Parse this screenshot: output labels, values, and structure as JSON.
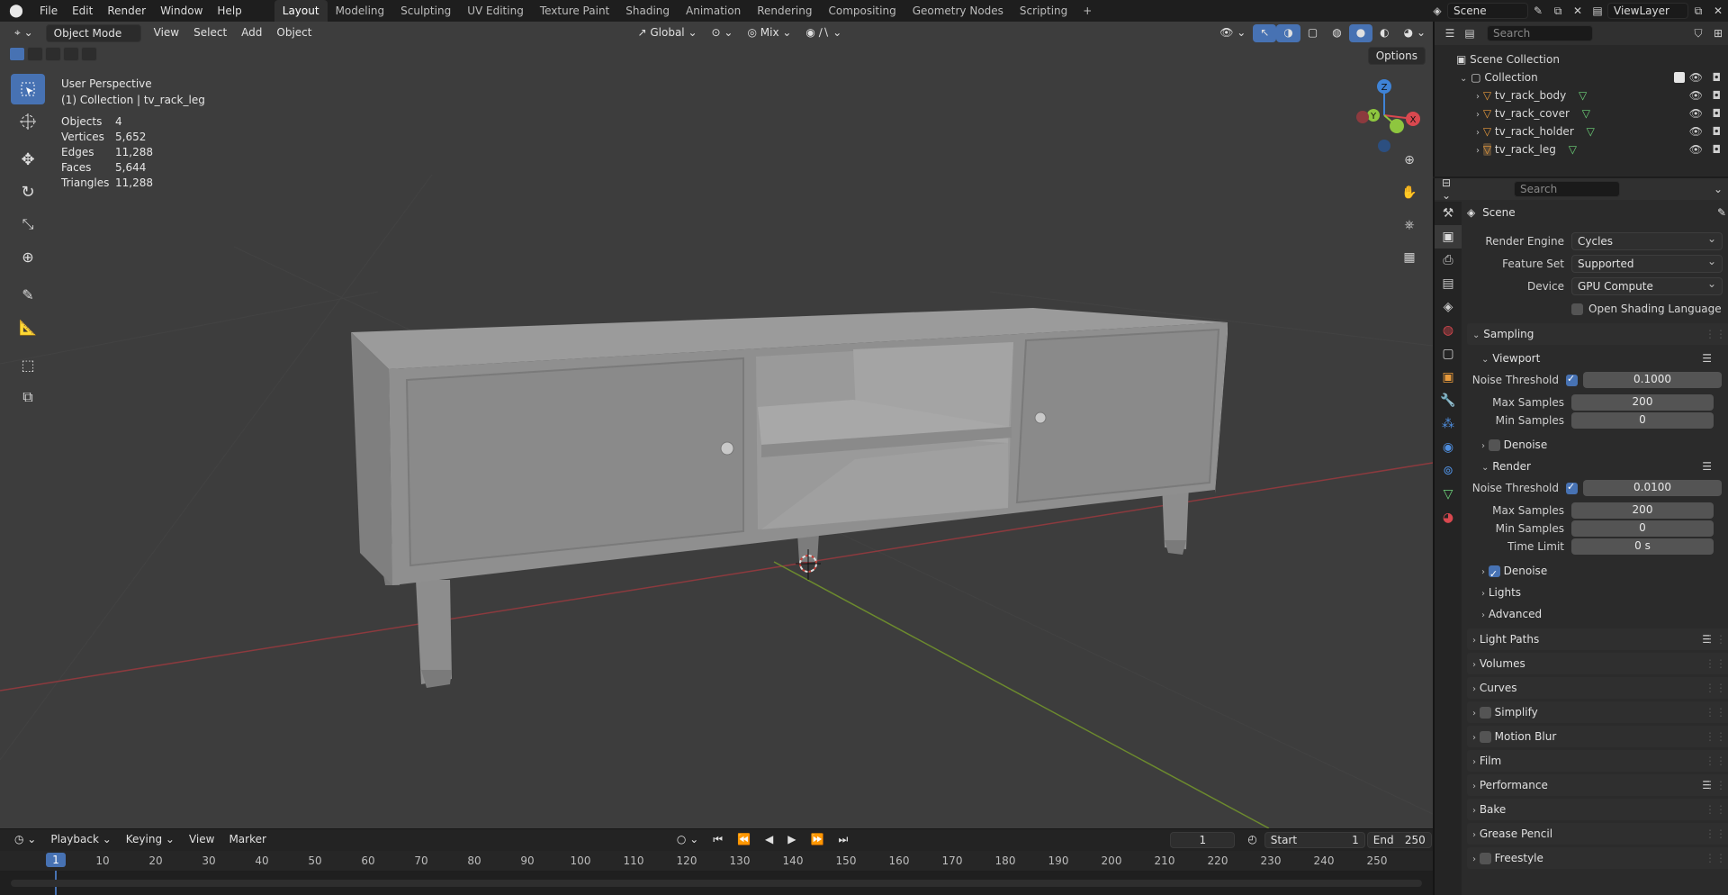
{
  "menu": {
    "file": "File",
    "edit": "Edit",
    "render": "Render",
    "window": "Window",
    "help": "Help"
  },
  "workspaces": [
    "Layout",
    "Modeling",
    "Sculpting",
    "UV Editing",
    "Texture Paint",
    "Shading",
    "Animation",
    "Rendering",
    "Compositing",
    "Geometry Nodes",
    "Scripting"
  ],
  "top_right": {
    "scene": "Scene",
    "view_layer": "ViewLayer"
  },
  "viewport": {
    "mode": "Object Mode",
    "menu": [
      "View",
      "Select",
      "Add",
      "Object"
    ],
    "orientation": "Global",
    "snap_mix": "Mix",
    "options": "Options",
    "perspective": "User Perspective",
    "collection_label": "(1) Collection | tv_rack_leg",
    "stats": [
      {
        "label": "Objects",
        "value": "4"
      },
      {
        "label": "Vertices",
        "value": "5,652"
      },
      {
        "label": "Edges",
        "value": "11,288"
      },
      {
        "label": "Faces",
        "value": "5,644"
      },
      {
        "label": "Triangles",
        "value": "11,288"
      }
    ],
    "gizmo": {
      "z": "Z",
      "y": "Y",
      "x": "X"
    }
  },
  "timeline": {
    "playback": "Playback",
    "keying": "Keying",
    "view": "View",
    "marker": "Marker",
    "current_frame": "1",
    "start_label": "Start",
    "start": "1",
    "end_label": "End",
    "end": "250",
    "ruler": [
      "10",
      "20",
      "30",
      "40",
      "50",
      "60",
      "70",
      "80",
      "90",
      "100",
      "110",
      "120",
      "130",
      "140",
      "150",
      "160",
      "170",
      "180",
      "190",
      "200",
      "210",
      "220",
      "230",
      "240",
      "250"
    ]
  },
  "outliner": {
    "search_placeholder": "Search",
    "scene_collection": "Scene Collection",
    "collection": "Collection",
    "objects": [
      "tv_rack_body",
      "tv_rack_cover",
      "tv_rack_holder",
      "tv_rack_leg"
    ]
  },
  "properties": {
    "search_placeholder": "Search",
    "context": "Scene",
    "render_engine_label": "Render Engine",
    "render_engine": "Cycles",
    "feature_set_label": "Feature Set",
    "feature_set": "Supported",
    "device_label": "Device",
    "device": "GPU Compute",
    "osl_label": "Open Shading Language",
    "sampling": "Sampling",
    "viewport": "Viewport",
    "noise_threshold_label": "Noise Threshold",
    "vp_noise_threshold": "0.1000",
    "max_samples_label": "Max Samples",
    "vp_max_samples": "200",
    "min_samples_label": "Min Samples",
    "vp_min_samples": "0",
    "denoise": "Denoise",
    "render": "Render",
    "r_noise_threshold": "0.0100",
    "r_max_samples": "200",
    "r_min_samples": "0",
    "time_limit_label": "Time Limit",
    "r_time_limit": "0 s",
    "lights": "Lights",
    "advanced": "Advanced",
    "panels": [
      "Light Paths",
      "Volumes",
      "Curves",
      "Simplify",
      "Motion Blur",
      "Film",
      "Performance",
      "Bake",
      "Grease Pencil",
      "Freestyle"
    ]
  },
  "colors": {
    "accent": "#4772b3",
    "x_axis": "#d9484f",
    "y_axis": "#8ec63f",
    "z_axis": "#3f83d6",
    "object_orange": "#e89a3c"
  }
}
